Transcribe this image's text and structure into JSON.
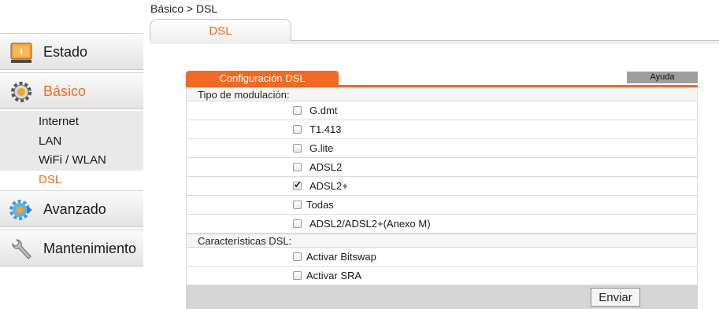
{
  "breadcrumb": "Básico > DSL",
  "tab": "DSL",
  "sidebar": {
    "items": [
      {
        "label": "Estado",
        "icon": "status-monitor-icon"
      },
      {
        "label": "Básico",
        "icon": "gear-icon"
      },
      {
        "label": "Avanzado",
        "icon": "advanced-gear-icon"
      },
      {
        "label": "Mantenimiento",
        "icon": "wrench-icon"
      }
    ],
    "subitems": [
      "Internet",
      "LAN",
      "WiFi / WLAN",
      "DSL"
    ]
  },
  "panel": {
    "title": "Configuración DSL",
    "help": "Ayuda",
    "modulation_label": "Tipo de modulación:",
    "modulation_options": [
      {
        "label": "G.dmt",
        "checked": false
      },
      {
        "label": "T1.413",
        "checked": false
      },
      {
        "label": "G.lite",
        "checked": false
      },
      {
        "label": "ADSL2",
        "checked": false
      },
      {
        "label": "ADSL2+",
        "checked": true
      },
      {
        "label": "Todas",
        "checked": false
      },
      {
        "label": "ADSL2/ADSL2+(Anexo M)",
        "checked": false
      }
    ],
    "features_label": "Características DSL:",
    "feature_options": [
      {
        "label": "Activar Bitswap",
        "checked": false
      },
      {
        "label": "Activar SRA",
        "checked": false
      }
    ],
    "submit": "Enviar"
  },
  "colors": {
    "accent": "#f26a21",
    "panel_border": "#dadada"
  }
}
